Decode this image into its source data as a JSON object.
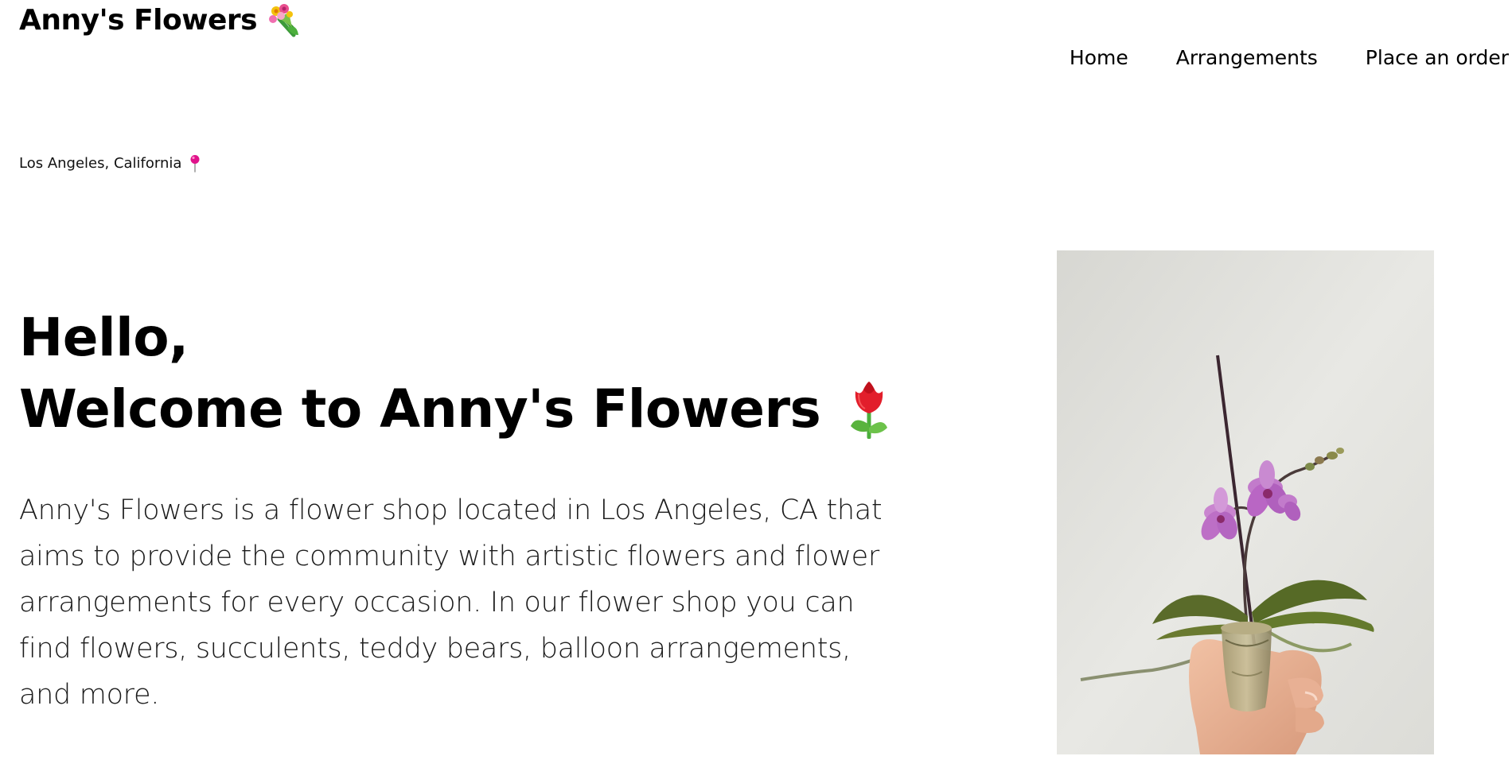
{
  "header": {
    "brand_name": "Anny's Flowers",
    "brand_icon": "bouquet-icon"
  },
  "nav": {
    "items": [
      {
        "label": "Home"
      },
      {
        "label": "Arrangements"
      },
      {
        "label": "Place an order"
      }
    ]
  },
  "location": {
    "text": "Los Angeles, California",
    "icon": "pushpin-icon",
    "icon_color": "#e0128b"
  },
  "hero": {
    "title_line1": "Hello,",
    "title_line2": "Welcome to Anny's Flowers",
    "title_icon": "tulip-icon",
    "description": "Anny's Flowers is a flower shop located in Los Angeles, CA that aims to provide the community with artistic flowers and flower arrangements for every occasion. In our flower shop you can find flowers, succulents, teddy bears, balloon arrangements, and more."
  },
  "photo": {
    "subject": "hand holding a potted purple orchid against a white wall"
  },
  "colors": {
    "background": "#ffffff",
    "text": "#000000",
    "orchid": "#b966c4"
  }
}
